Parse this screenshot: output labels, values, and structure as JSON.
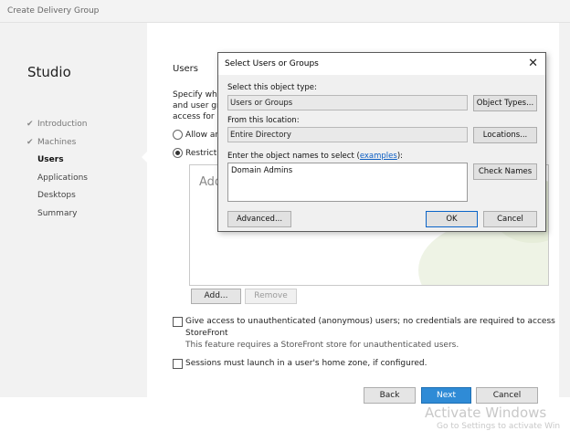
{
  "window": {
    "title": "Create Delivery Group"
  },
  "sidebar": {
    "app_title": "Studio",
    "items": [
      {
        "label": "Introduction",
        "state": "done"
      },
      {
        "label": "Machines",
        "state": "done"
      },
      {
        "label": "Users",
        "state": "active"
      },
      {
        "label": "Applications",
        "state": "pending"
      },
      {
        "label": "Desktops",
        "state": "pending"
      },
      {
        "label": "Summary",
        "state": "pending"
      }
    ]
  },
  "main": {
    "heading": "Users",
    "intro_lines": [
      "Specify who",
      "and user gro",
      "access for u"
    ],
    "radio_allow": "Allow an",
    "radio_restrict": "Restrict u",
    "list_placeholder": "Add",
    "add_button": "Add...",
    "remove_button": "Remove",
    "unauth_checkbox_line1": "Give access to unauthenticated (anonymous) users; no credentials are required to access",
    "unauth_checkbox_line2": "StoreFront",
    "unauth_note": "This feature requires a StoreFront store for unauthenticated users.",
    "homezone_checkbox": "Sessions must launch in a user's home zone, if configured."
  },
  "footer": {
    "back": "Back",
    "next": "Next",
    "cancel": "Cancel"
  },
  "modal": {
    "title": "Select Users or Groups",
    "object_type_label": "Select this object type:",
    "object_type_value": "Users or Groups",
    "object_types_button": "Object Types...",
    "location_label": "From this location:",
    "location_value": "Entire Directory",
    "locations_button": "Locations...",
    "names_label_prefix": "Enter the object names to select (",
    "names_label_link": "examples",
    "names_label_suffix": "):",
    "names_value": "Domain Admins",
    "check_names_button": "Check Names",
    "advanced_button": "Advanced...",
    "ok_button": "OK",
    "cancel_button": "Cancel"
  },
  "watermark": {
    "line1": "Activate Windows",
    "line2": "Go to Settings to activate Win"
  }
}
